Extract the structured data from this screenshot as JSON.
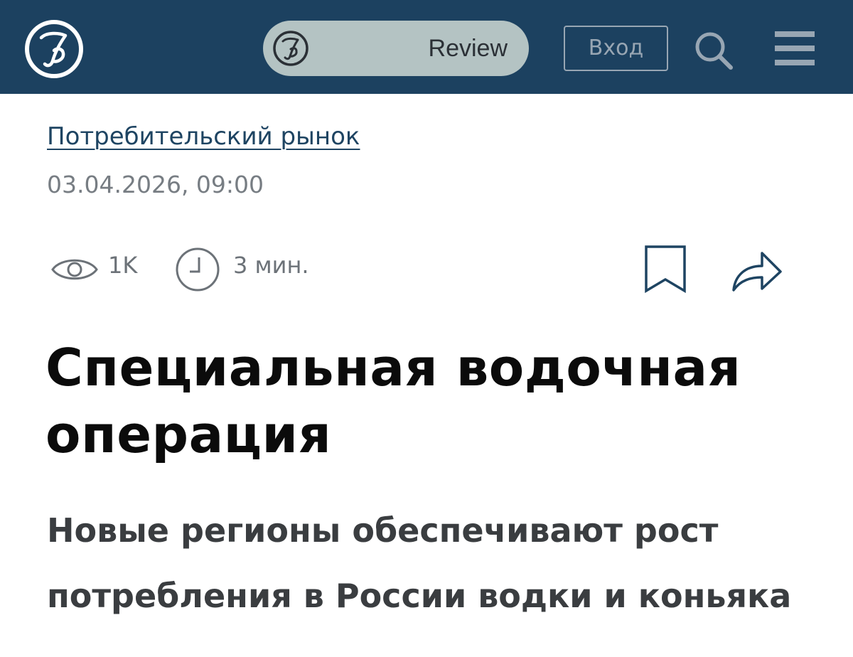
{
  "header": {
    "logo_icon": "kommersant-logo-icon",
    "review": {
      "label": "Review",
      "icon": "kommersant-logo-icon"
    },
    "login_label": "Вход",
    "search_icon": "search-icon",
    "menu_icon": "hamburger-menu-icon",
    "colors": {
      "background": "#1c4160",
      "pill": "#b4c3c3"
    }
  },
  "article": {
    "category": "Потребительский рынок",
    "datetime": "03.04.2026, 09:00",
    "views": "1K",
    "read_time": "3 мин.",
    "title": "Специальная водочная операция",
    "subtitle": "Новые регионы обеспечивают рост потребления в России водки и коньяка"
  },
  "icons": {
    "views": "eye-icon",
    "read_time": "clock-icon",
    "bookmark": "bookmark-icon",
    "share": "share-icon"
  }
}
